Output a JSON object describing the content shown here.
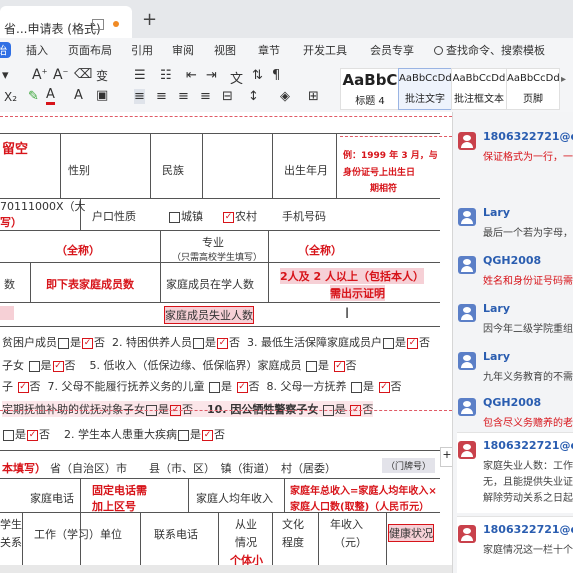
{
  "tabs": {
    "doc_tab": "省...申请表 (格式)",
    "new_tab": "+"
  },
  "menu": [
    "始",
    "插入",
    "页面布局",
    "引用",
    "审阅",
    "视图",
    "章节",
    "开发工具",
    "会员专享"
  ],
  "search_placeholder": "查找命令、搜索模板",
  "styles": [
    {
      "sample": "AaBbC",
      "name": "标题 4"
    },
    {
      "sample": "AaBbCcDd",
      "name": "批注文字"
    },
    {
      "sample": "AaBbCcDd",
      "name": "批注框文本"
    },
    {
      "sample": "AaBbCcDd",
      "name": "页脚"
    }
  ],
  "document": {
    "name_red": "留空",
    "gender": "性别",
    "ethnicity": "民族",
    "birth": "出生年月",
    "birth_example": "例：1999 年 3 月，与",
    "birth_example2": "身份证号上出生日",
    "birth_example3": "期相符",
    "id_num": "70111000X（大",
    "id_num2": "写）",
    "hukou": "户口性质",
    "town": "城镇",
    "village": "农村",
    "phone": "手机号码",
    "fullname1": "（全称）",
    "major": "专业",
    "major_note": "（只需高校学生填写）",
    "fullname2": "（全称）",
    "count": "数",
    "family_count_note": "即下表家庭成员数",
    "students_count": "家庭成员在学人数",
    "two_or_more": "2人及 2 人以上（包括本人）",
    "need_proof": "需出示证明",
    "unemployed": "家庭成员失业人数",
    "cond1": "贫困户成员",
    "cond2": "2. 特困供养人员",
    "cond3": "3. 最低生活保障家庭成员户",
    "no": "否",
    "yes": "是",
    "cond4a": "子女",
    "cond5": "5. 低收入（低保边缘、低保临界）家庭成员",
    "cond6a": "子",
    "cond7": "7. 父母不能履行抚养义务的儿童",
    "cond8": "8. 父母一方抚养",
    "cond9": "定期抚恤补助的优抚对象子女",
    "cond10": "10. 因公牺牲警察子女",
    "cond11": "2. 学生本人患重大疾病",
    "address_red": "本填写）",
    "address": "省（自治区）市　　县（市、区）　镇（街道）　村（居委）",
    "house_num": "（门牌号）",
    "home_phone": "家庭电话",
    "fixed_phone": "固定电话需",
    "fixed_phone2": "加上区号",
    "avg_income": "家庭人均年收入",
    "income_formula": "家庭年总收入=家庭人均年收入×",
    "income_formula2": "家庭人口数(取整)（人民币元）",
    "col_student": "学生",
    "col_relation": "关系",
    "col_work": "工作（学习）单位",
    "col_phone": "联系电话",
    "col_job": "从业",
    "col_job2": "情况",
    "col_edu": "文化",
    "col_edu2": "程度",
    "col_income": "年收入",
    "col_income2": "（元）",
    "col_health": "健康状况",
    "self_employed": "个体小"
  },
  "comments": [
    {
      "author": "1806322721@qq.",
      "text": "保证格式为一行，一行",
      "red": true,
      "avatar": "red"
    },
    {
      "author": "Lary",
      "text": "最后一个若为字母，",
      "red": false,
      "avatar": "blue"
    },
    {
      "author": "QGH2008",
      "text": "姓名和身份证号码需",
      "red": true,
      "avatar": "blue"
    },
    {
      "author": "Lary",
      "text": "因今年二级学院重组",
      "red": false,
      "avatar": "blue"
    },
    {
      "author": "Lary",
      "text": "九年义务教育的不需",
      "red": false,
      "avatar": "blue"
    },
    {
      "author": "QGH2008",
      "text": "包含尽义务赡养的老",
      "red": true,
      "avatar": "blue"
    },
    {
      "author": "1806322721@qq.",
      "text": "家庭失业人数：工作",
      "text2": "无，且能提供失业证",
      "text3": "解除劳动关系之日起",
      "red": false,
      "avatar": "red"
    },
    {
      "author": "1806322721@qq.",
      "text": "家庭情况这一栏十个",
      "red": false,
      "avatar": "red"
    }
  ],
  "colors": {
    "accent": "#2f6fe4",
    "revision_red": "#d7141a",
    "comment_author": "#2a5db0"
  }
}
